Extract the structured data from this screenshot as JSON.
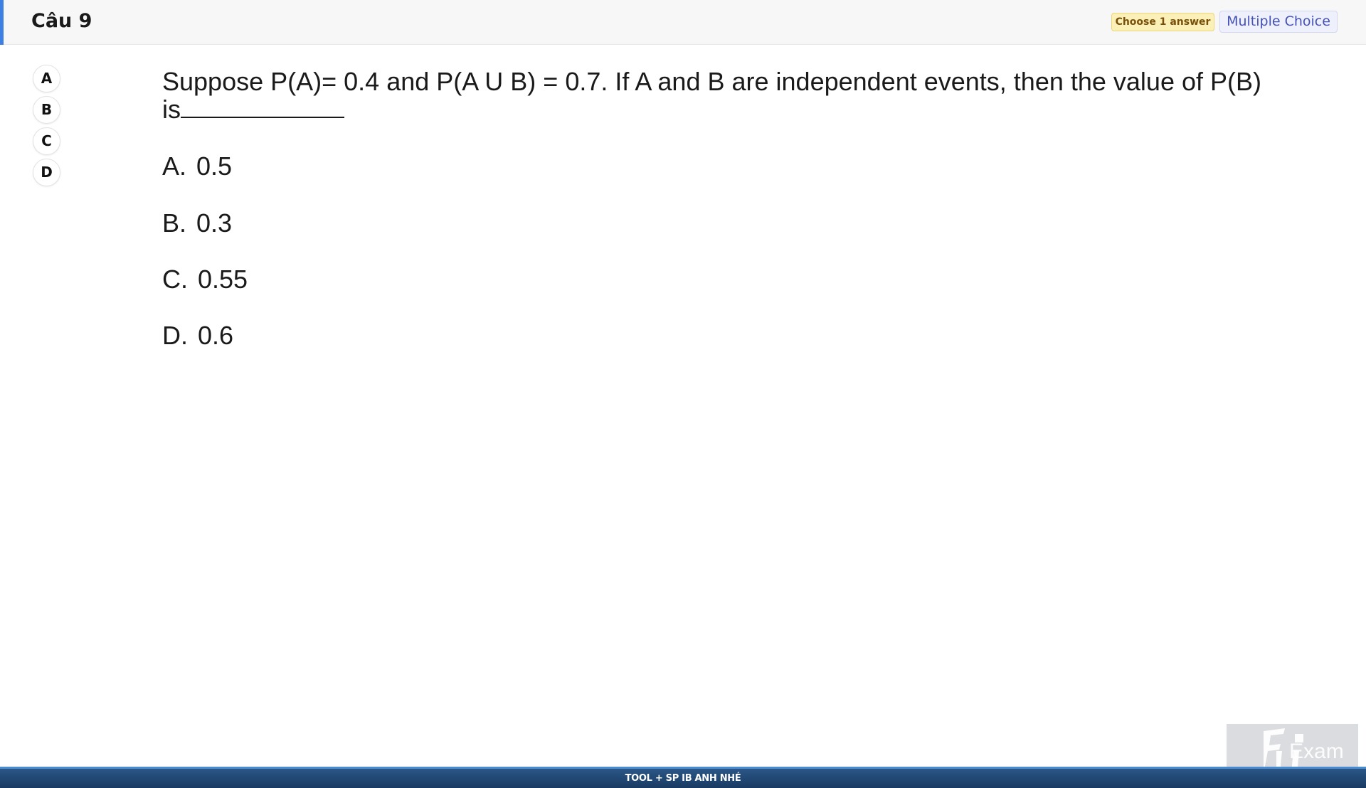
{
  "header": {
    "question_title": "Câu 9",
    "badge_choose": "Choose 1 answer",
    "badge_type": "Multiple Choice",
    "accent_color": "#3d7fe3"
  },
  "answer_buttons": [
    "A",
    "B",
    "C",
    "D"
  ],
  "question": {
    "text": "Suppose P(A)= 0.4 and P(A U B) = 0.7. If A and B are independent events, then the value of P(B) is"
  },
  "options": [
    {
      "letter": "A.",
      "value": "0.5"
    },
    {
      "letter": "B.",
      "value": "0.3"
    },
    {
      "letter": "C.",
      "value": "0.55"
    },
    {
      "letter": "D.",
      "value": "0.6"
    }
  ],
  "footer": {
    "text": "TOOL + SP IB ANH NHÉ"
  },
  "watermark": {
    "logo_text": "FU Exam",
    "icon": "fu-exam-logo"
  }
}
